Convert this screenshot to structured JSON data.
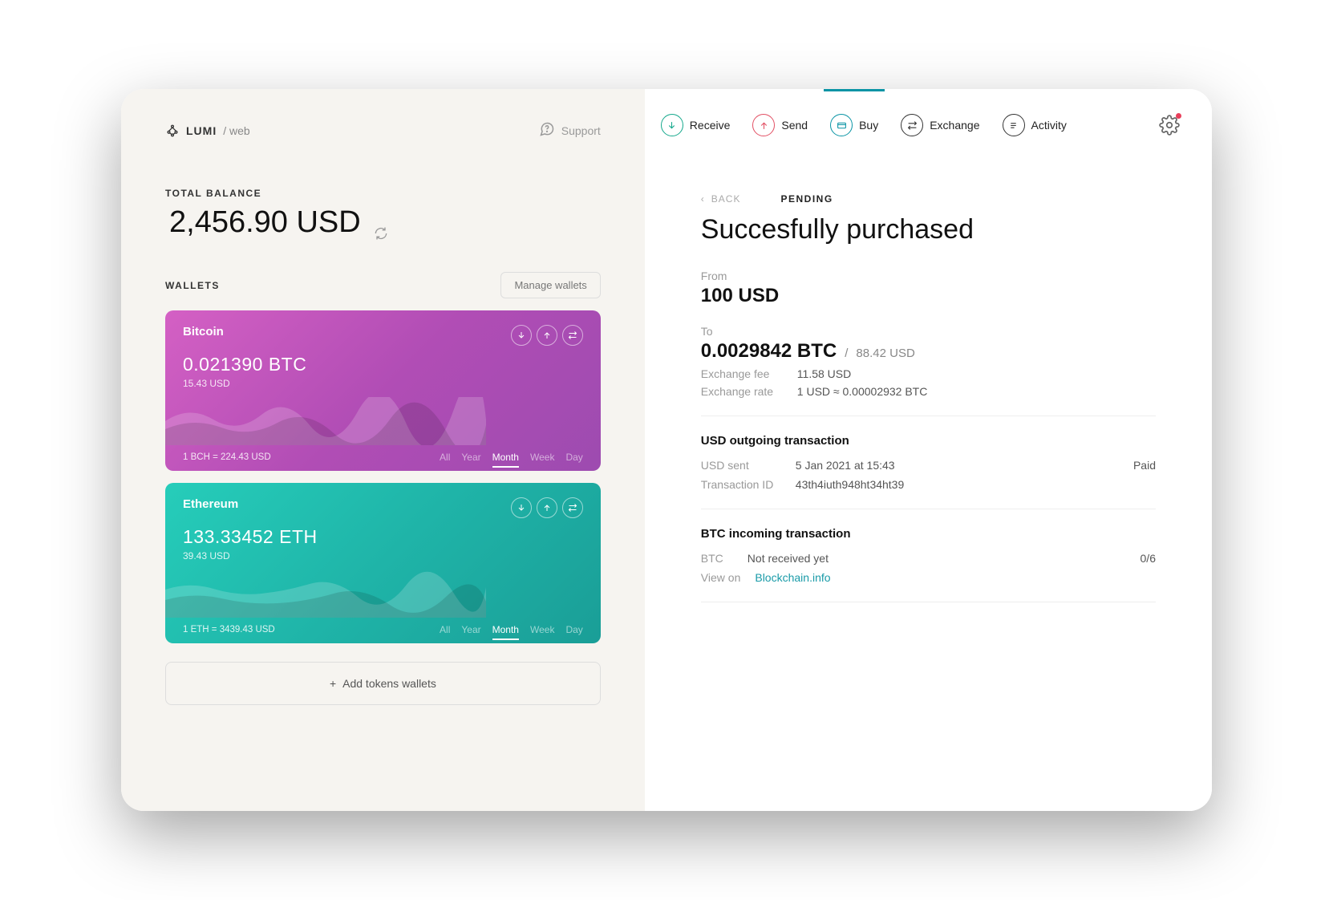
{
  "brand": {
    "name": "LUMI",
    "sub": "/ web"
  },
  "support_label": "Support",
  "total": {
    "label": "TOTAL BALANCE",
    "amount": "2,456.90 USD"
  },
  "wallets_label": "WALLETS",
  "manage_label": "Manage wallets",
  "wallets": [
    {
      "name": "Bitcoin",
      "amount": "0.021390 BTC",
      "usd": "15.43 USD",
      "rate": "1 BCH = 224.43 USD",
      "ranges": [
        "All",
        "Year",
        "Month",
        "Week",
        "Day"
      ],
      "active_range": "Month"
    },
    {
      "name": "Ethereum",
      "amount": "133.33452 ETH",
      "usd": "39.43 USD",
      "rate": "1 ETH = 3439.43 USD",
      "ranges": [
        "All",
        "Year",
        "Month",
        "Week",
        "Day"
      ],
      "active_range": "Month"
    }
  ],
  "add_wallet_label": "Add tokens wallets",
  "nav": {
    "receive": "Receive",
    "send": "Send",
    "buy": "Buy",
    "exchange": "Exchange",
    "activity": "Activity"
  },
  "back_label": "BACK",
  "pending_label": "PENDING",
  "tx_title": "Succesfully purchased",
  "from_label": "From",
  "from_amount": "100 USD",
  "to_label": "To",
  "to_amount": "0.0029842 BTC",
  "to_usd": "88.42 USD",
  "fee_label": "Exchange fee",
  "fee_value": "11.58 USD",
  "rate_label": "Exchange rate",
  "rate_value": "1 USD ≈ 0.00002932 BTC",
  "out_section": {
    "title": "USD outgoing transaction",
    "sent_label": "USD sent",
    "sent_value": "5 Jan 2021 at 15:43",
    "status": "Paid",
    "txid_label": "Transaction ID",
    "txid_value": "43th4iuth948ht34ht39"
  },
  "in_section": {
    "title": "BTC incoming transaction",
    "btc_label": "BTC",
    "btc_value": "Not received yet",
    "count": "0/6",
    "view_label": "View on",
    "view_link": "Blockchain.info"
  }
}
